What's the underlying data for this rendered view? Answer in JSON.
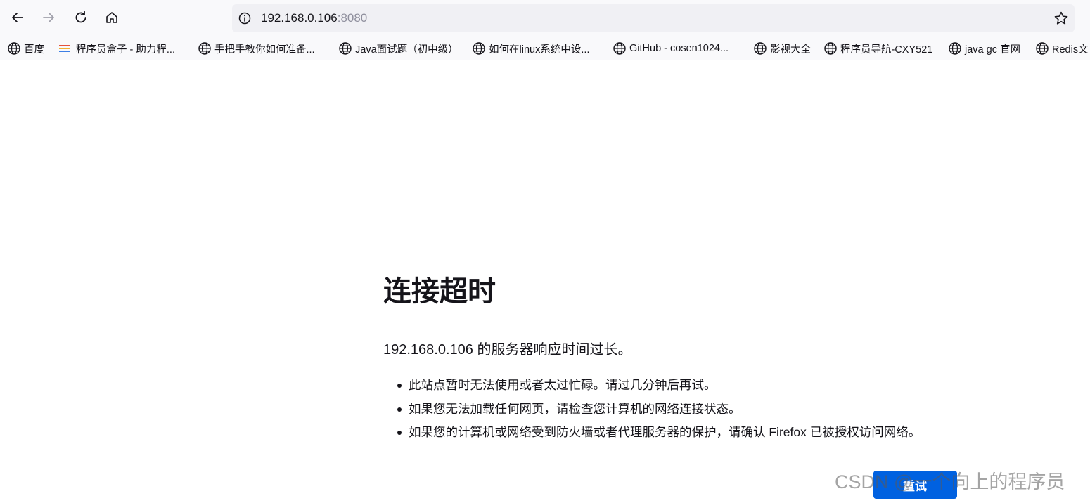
{
  "browser": {
    "url_host": "192.168.0.106",
    "url_port": ":8080",
    "bookmarks": [
      {
        "label": "百度",
        "icon": "globe-icon"
      },
      {
        "label": "程序员盒子 - 助力程...",
        "icon": "csdn-favicon"
      },
      {
        "label": "手把手教你如何准备...",
        "icon": "globe-icon"
      },
      {
        "label": "Java面试题（初中级）",
        "icon": "globe-icon"
      },
      {
        "label": "如何在linux系统中设...",
        "icon": "globe-icon"
      },
      {
        "label": "GitHub - cosen1024...",
        "icon": "globe-icon"
      },
      {
        "label": "影视大全",
        "icon": "globe-icon"
      },
      {
        "label": "程序员导航-CXY521",
        "icon": "globe-icon"
      },
      {
        "label": "java gc 官网",
        "icon": "globe-icon"
      },
      {
        "label": "Redis文",
        "icon": "globe-icon"
      }
    ]
  },
  "error": {
    "title": "连接超时",
    "description": "192.168.0.106 的服务器响应时间过长。",
    "items": [
      "此站点暂时无法使用或者太过忙碌。请过几分钟后再试。",
      "如果您无法加载任何网页，请检查您计算机的网络连接状态。",
      "如果您的计算机或网络受到防火墙或者代理服务器的保护，请确认 Firefox 已被授权访问网络。"
    ],
    "retry_label": "重试"
  },
  "watermark": "CSDN @一个向上的程序员",
  "colors": {
    "accent": "#0061e0",
    "toolbar_bg": "#f9f9fb",
    "urlbar_bg": "#f0f0f4",
    "text": "#15141a"
  }
}
